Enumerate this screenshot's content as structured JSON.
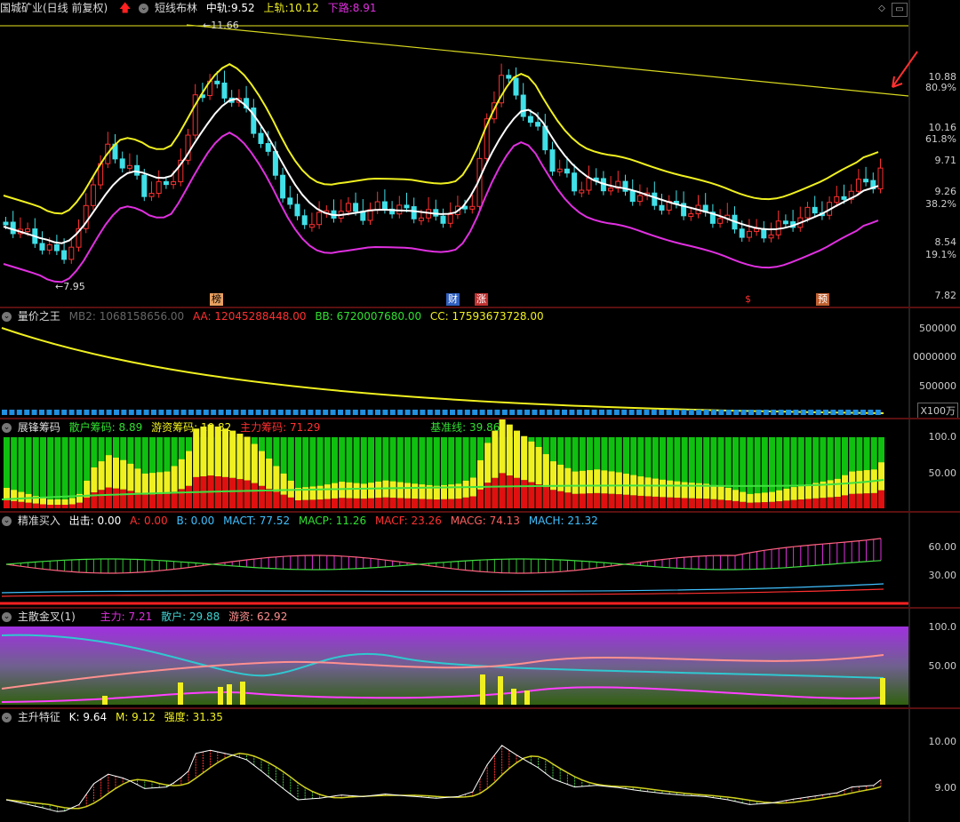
{
  "main": {
    "title": "国城矿业(日线 前复权)",
    "indicator_name": "短线布林",
    "mid_label": "中轨:",
    "mid_value": "9.52",
    "upper_label": "上轨:",
    "upper_value": "10.12",
    "lower_label": "下路:",
    "lower_value": "8.91",
    "high_mark": "11.66",
    "low_mark": "7.95",
    "axis_ticks": [
      "10.88",
      "80.9%",
      "10.16",
      "61.8%",
      "9.71",
      "9.26",
      "38.2%",
      "8.54",
      "19.1%",
      "7.82"
    ],
    "tags": [
      "榜",
      "财",
      "涨",
      "$",
      "预"
    ],
    "colors": {
      "up": "#ff3030",
      "down": "#40e0e8",
      "upper": "#f0f020",
      "mid": "#ffffff",
      "lower": "#e030e0",
      "trend": "#d8d820"
    }
  },
  "vol": {
    "title": "量价之王",
    "mb2_label": "MB2: ",
    "mb2_value": "1068158656.00",
    "aa_label": "AA: ",
    "aa_value": "12045288448.00",
    "bb_label": "BB: ",
    "bb_value": "6720007680.00",
    "cc_label": "CC: ",
    "cc_value": "17593673728.00",
    "axis_ticks": [
      "500000",
      "0000000",
      "500000"
    ],
    "unit": "X100万"
  },
  "chips": {
    "title": "展锋筹码",
    "retail_label": "散户筹码: ",
    "retail_value": "8.89",
    "hot_label": "游资筹码: ",
    "hot_value": "19.82",
    "main_label": "主力筹码: ",
    "main_value": "71.29",
    "base_label": "基准线: ",
    "base_value": "39.86",
    "axis_ticks": [
      "100.0",
      "50.00"
    ]
  },
  "precise": {
    "title": "精准买入",
    "out_label": "出击: ",
    "out_value": "0.00",
    "a_label": "A: ",
    "a_value": "0.00",
    "b_label": "B: ",
    "b_value": "0.00",
    "mact_label": "MACT: ",
    "mact_value": "77.52",
    "macp_label": "MACP: ",
    "macp_value": "11.26",
    "macf_label": "MACF: ",
    "macf_value": "23.26",
    "macg_label": "MACG: ",
    "macg_value": "74.13",
    "mach_label": "MACH: ",
    "mach_value": "21.32",
    "axis_ticks": [
      "60.00",
      "30.00"
    ]
  },
  "gold": {
    "title": "主散金叉(1)",
    "main_label": "主力: ",
    "main_value": "7.21",
    "retail_label": "散户: ",
    "retail_value": "29.88",
    "hot_label": "游资: ",
    "hot_value": "62.92",
    "axis_ticks": [
      "100.0",
      "50.00"
    ]
  },
  "rise": {
    "title": "主升特征",
    "k_label": "K: ",
    "k_value": "9.64",
    "m_label": "M: ",
    "m_value": "9.12",
    "s_label": "强度: ",
    "s_value": "31.35",
    "axis_ticks": [
      "10.00",
      "9.00"
    ]
  }
}
